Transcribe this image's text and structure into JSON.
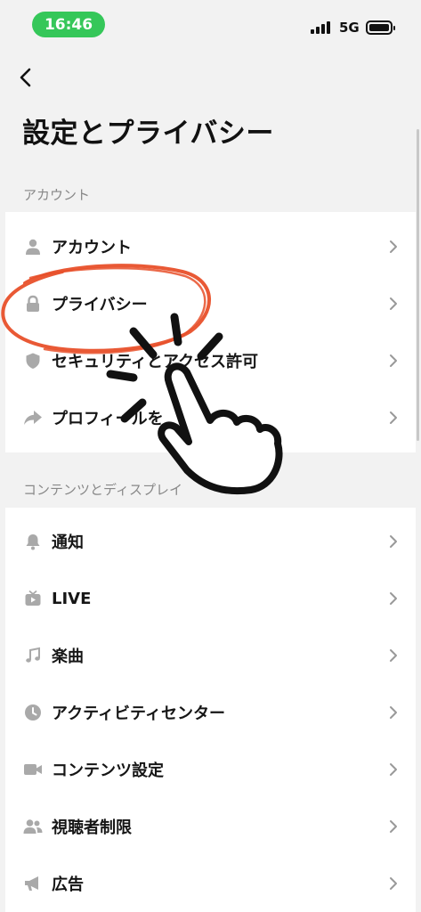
{
  "status_bar": {
    "time": "16:46",
    "network": "5G"
  },
  "header": {
    "title": "設定とプライバシー"
  },
  "sections": [
    {
      "header": "アカウント",
      "items": [
        {
          "label": "アカウント",
          "icon": "person-icon"
        },
        {
          "label": "プライバシー",
          "icon": "lock-icon"
        },
        {
          "label": "セキュリティとアクセス許可",
          "icon": "shield-icon"
        },
        {
          "label": "プロフィールを",
          "icon": "share-arrow-icon"
        }
      ]
    },
    {
      "header": "コンテンツとディスプレイ",
      "items": [
        {
          "label": "通知",
          "icon": "bell-icon"
        },
        {
          "label": "LIVE",
          "icon": "tv-icon"
        },
        {
          "label": "楽曲",
          "icon": "music-note-icon"
        },
        {
          "label": "アクティビティセンター",
          "icon": "clock-icon"
        },
        {
          "label": "コンテンツ設定",
          "icon": "video-camera-icon"
        },
        {
          "label": "視聴者制限",
          "icon": "people-icon"
        },
        {
          "label": "広告",
          "icon": "megaphone-icon"
        }
      ]
    }
  ],
  "colors": {
    "time_pill": "#35c759",
    "highlight_circle": "#e8502a",
    "hand_cursor": "#111111"
  }
}
